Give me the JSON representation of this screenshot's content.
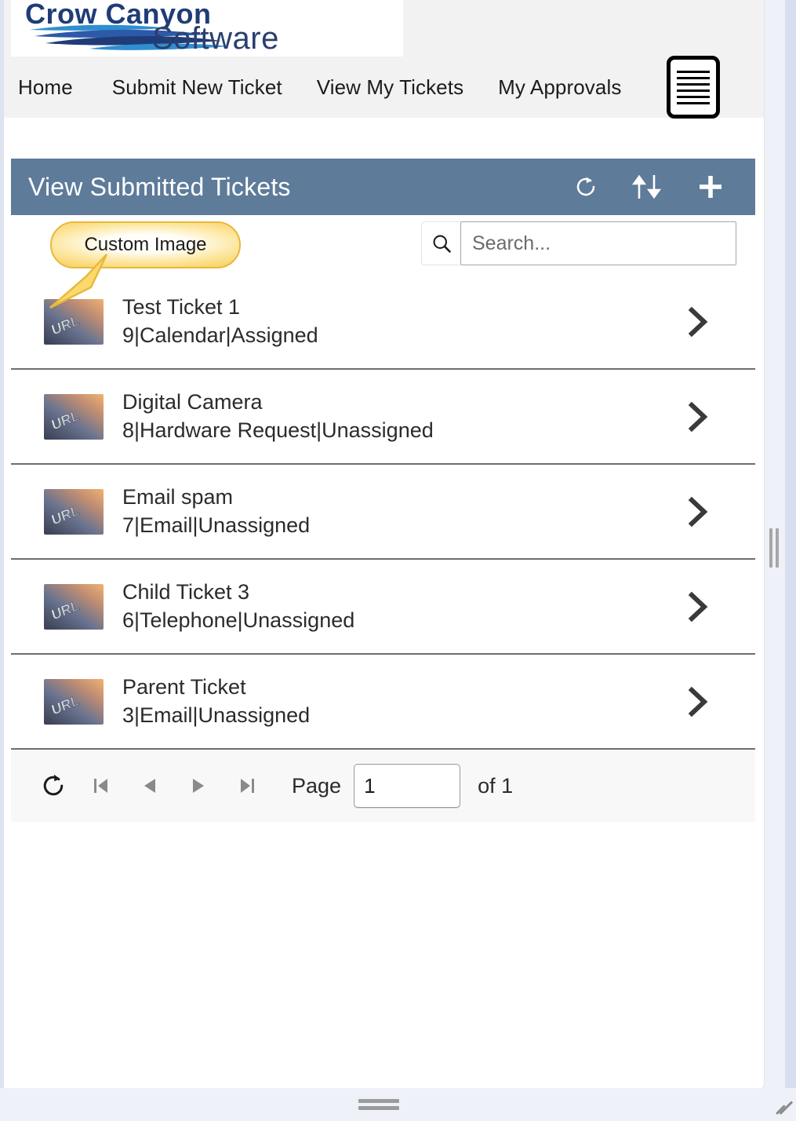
{
  "brand": {
    "name_line1": "Crow Canyon",
    "name_line2": "Software",
    "logo_navy": "#1f3c78",
    "logo_blue": "#1f7fc4",
    "logo_midblue": "#2d5aa8"
  },
  "nav": {
    "items": [
      {
        "label": "Home",
        "name": "nav-home"
      },
      {
        "label": "Submit New Ticket",
        "name": "nav-submit-new-ticket"
      },
      {
        "label": "View My Tickets",
        "name": "nav-view-my-tickets"
      },
      {
        "label": "My Approvals",
        "name": "nav-my-approvals"
      }
    ],
    "menu_icon": "hamburger-menu-icon"
  },
  "webpart": {
    "title": "View Submitted Tickets",
    "header_color": "#5e7b9a",
    "actions": [
      {
        "name": "refresh-icon",
        "label": "Refresh"
      },
      {
        "name": "sort-icon",
        "label": "Sort"
      },
      {
        "name": "add-icon",
        "label": "Add"
      }
    ]
  },
  "search": {
    "placeholder": "Search...",
    "value": "",
    "icon": "search-icon"
  },
  "callout": {
    "text": "Custom Image",
    "fill": "#f8d46a",
    "border": "#e8b93c"
  },
  "tickets": [
    {
      "title": "Test Ticket 1",
      "subtitle": "9|Calendar|Assigned",
      "thumb": "url-image-thumbnail"
    },
    {
      "title": "Digital Camera",
      "subtitle": "8|Hardware Request|Unassigned",
      "thumb": "url-image-thumbnail"
    },
    {
      "title": "Email spam",
      "subtitle": "7|Email|Unassigned",
      "thumb": "url-image-thumbnail"
    },
    {
      "title": "Child Ticket 3",
      "subtitle": "6|Telephone|Unassigned",
      "thumb": "url-image-thumbnail"
    },
    {
      "title": "Parent Ticket",
      "subtitle": "3|Email|Unassigned",
      "thumb": "url-image-thumbnail"
    }
  ],
  "pager": {
    "refresh": "refresh-icon",
    "first": "first-page-icon",
    "prev": "previous-page-icon",
    "next": "next-page-icon",
    "last": "last-page-icon",
    "page_label": "Page",
    "page_value": "1",
    "of_label": "of 1"
  },
  "thumbnail": {
    "caption": "URL"
  }
}
